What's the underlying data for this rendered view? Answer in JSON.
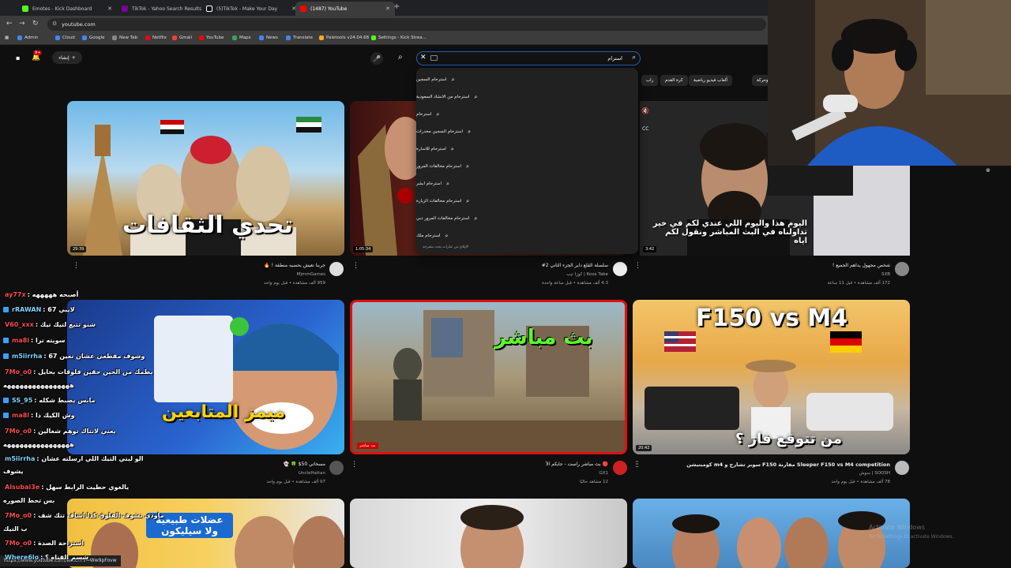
{
  "browser": {
    "tabs": [
      {
        "label": "Emotes - Kick Dashboard",
        "color": "#53fc18"
      },
      {
        "label": "TikTok - Yahoo Search Results",
        "color": "#7b0099"
      },
      {
        "label": "(5)TikTok - Make Your Day",
        "color": "#111111"
      },
      {
        "label": "(1487) YouTube",
        "color": "#ff0000"
      }
    ],
    "new_tab": "+",
    "url": "youtube.com",
    "bookmarks": [
      {
        "label": "Admin",
        "color": "#4285f4"
      },
      {
        "label": "Cloud",
        "color": "#4285f4"
      },
      {
        "label": "Google",
        "color": "#4285f4"
      },
      {
        "label": "New Tab",
        "color": "#888888"
      },
      {
        "label": "Netflix",
        "color": "#e50914"
      },
      {
        "label": "Gmail",
        "color": "#ea4335"
      },
      {
        "label": "YouTube",
        "color": "#ff0000"
      },
      {
        "label": "Maps",
        "color": "#34a853"
      },
      {
        "label": "News",
        "color": "#4285f4"
      },
      {
        "label": "Translate",
        "color": "#4285f4"
      },
      {
        "label": "Paletools v24.04.68",
        "color": "#f9a825"
      },
      {
        "label": "Settings - Kick Strea...",
        "color": "#53fc18"
      }
    ]
  },
  "header": {
    "create_label": "إنشاء",
    "notif_count": "9+",
    "search_value": "استرام",
    "clear_icon": "✕"
  },
  "chips": [
    "مباريات وحركة",
    "ألعاب فيديو رياضية",
    "كرة القدم",
    "راب"
  ],
  "suggestions": [
    "استرحام السجين",
    "استرحام من الانشاد السعودية",
    "استرحام",
    "استرحام السجين مخدرات",
    "استرحام للاسارة",
    "استرحام مخالفات المرور",
    "استرحام ابشر",
    "استرحام مخالفات الزيارة",
    "استرحام مخالفات المرور دبي",
    "استرحام ملك"
  ],
  "suggestions_report": "الإبلاغ عن عبارات بحث مقترحة",
  "videos": [
    {
      "thumb_text": "تحدي الثقافات",
      "duration": "29:39",
      "title": "جربنا نعيش بحضيه منطقة ! 🔥",
      "channel": "MjmmGames",
      "meta": "959 ألف مشاهدة • قبل يوم واحد"
    },
    {
      "thumb_text": "",
      "duration": "1:05:34",
      "title": "سلسلة القلع داير الجزء الثاني 2#",
      "channel": "Koza Tabe | كوزا تيب",
      "meta": "4.3 ألف مشاهدة • قبل ساعة واحدة"
    },
    {
      "thumb_text": "",
      "duration": "3:42",
      "title": "شخص مجهول يداهم الجميع !",
      "channel": "SXB",
      "meta": "172 ألف مشاهدة • قبل 11 ساعة"
    },
    {
      "thumb_text": "ميمز المتابعين",
      "duration": "",
      "title": "مسخاتي 50$ 🍀 👻",
      "channel": "UncleHattan",
      "meta": "97 ألف مشاهدة • قبل يوم واحد"
    },
    {
      "thumb_text": "بث مباشر",
      "duration": "",
      "title": "🔴 بث مباشر راست - جايكم الآ",
      "channel": "GX1",
      "meta": "12 مشاهد حاليًا",
      "live_badge": "بث مباشر"
    },
    {
      "thumb_text": "F150 vs M4",
      "thumb_sub": "من تتوقع فاز ؟",
      "duration": "20:42",
      "title": "Sleeper F150 vs M4 competition مقارنة F150 سوبر تشارج و m4 كومبتيشن",
      "channel": "SOOSH | سوش",
      "meta": "78 ألف مشاهدة • قبل يوم واحد"
    },
    {
      "thumb_text": "عضلات طبيعية ولا سيليكون",
      "duration": "",
      "title": "",
      "channel": "",
      "meta": ""
    },
    {
      "thumb_text": "",
      "duration": "",
      "title": "",
      "channel": "",
      "meta": ""
    },
    {
      "thumb_text": "",
      "duration": "",
      "title": "",
      "channel": "",
      "meta": ""
    }
  ],
  "webcam_subtitle": "اليوم هذا واليوم اللي عندي لكم في خير تداولناه في البث المباشر ونقول لكم اياه",
  "chat": [
    {
      "user": "ay77x",
      "msg": ": أصبحه هههههه",
      "color": "#ff4b4b"
    },
    {
      "user": "rRAWAN",
      "msg": ": 67 لايبي",
      "color": "#7fd3ff"
    },
    {
      "user": "V60_xxx",
      "msg": ": شنو تتبع لتيك تيك",
      "color": "#ff4b4b"
    },
    {
      "user": "ma8i",
      "msg": ": سويته ترا",
      "color": "#ff4b4b"
    },
    {
      "user": "m5iirrha",
      "msg": ": وشوف مقطعي عشان نعين 67",
      "color": "#7fd3ff"
    },
    {
      "user": "7Mo_o0",
      "msg": ": يطمك من الحين حقين فلوقات بحايل",
      "color": "#ff4b4b"
    },
    {
      "user": "",
      "msg": "ههههههههههههههههه",
      "color": "#ffffff"
    },
    {
      "user": "SS_95",
      "msg": ": مابس يضبط شكله",
      "color": "#7fd3ff"
    },
    {
      "user": "ma8i",
      "msg": ": وش الكيك ذا",
      "color": "#ff4b4b"
    },
    {
      "user": "7Mo_o0",
      "msg": ": يعني لانتاك توهم شغالين",
      "color": "#ff4b4b"
    },
    {
      "user": "",
      "msg": "ههههههههههههههههه",
      "color": "#ffffff"
    },
    {
      "user": "m5iirrha",
      "msg": ": الو لبتي التيك اللي ارسلته عشان",
      "color": "#7fd3ff"
    },
    {
      "user": "",
      "msg": "يشوف",
      "color": "#ffffff"
    },
    {
      "user": "Alsubai3e",
      "msg": ": يالغوي حطيت الرابط سهل",
      "color": "#ff4b4b"
    },
    {
      "user": "",
      "msg": "بس تحط الصوره",
      "color": "#ffffff"
    },
    {
      "user": "7Mo_o0",
      "msg": ": ماودي تشوف الفلوق كذا اشاف تتك شف",
      "color": "#ff4b4b"
    },
    {
      "user": "",
      "msg": "ب التيك",
      "color": "#ffffff"
    },
    {
      "user": "7Mo_o0",
      "msg": ": استراحة الصدة",
      "color": "#ff4b4b"
    },
    {
      "user": "Where6lo",
      "msg": ": شسم القناه ؟",
      "color": "#7fd3ff"
    }
  ],
  "status_url": "https://www.youtube.com/watch?v=Ww9pFovw",
  "watermark": {
    "line1": "Activate Windows",
    "line2": "Go to Settings to activate Windows."
  }
}
